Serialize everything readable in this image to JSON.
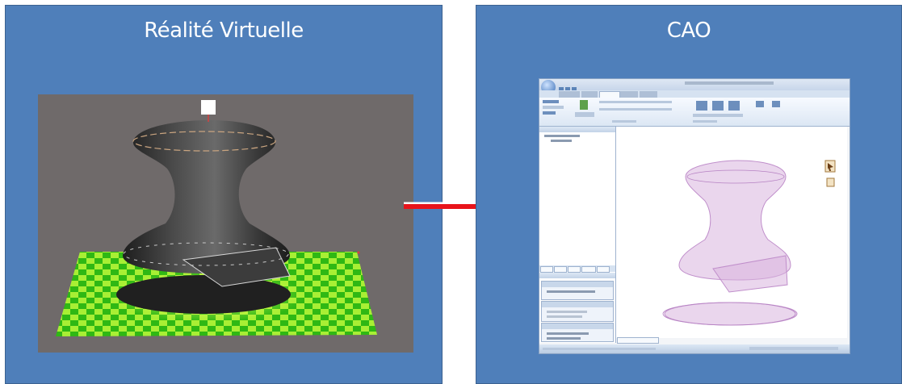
{
  "panels": {
    "left": {
      "title": "Réalité Virtuelle"
    },
    "right": {
      "title": "CAO"
    }
  },
  "colors": {
    "panel_background": "#4f7fba",
    "arrow": "#e8141b",
    "vr_viewport": "#6f6a6a",
    "checker_green": "#3cc21a",
    "checker_light": "#a8ef34",
    "vr_model": "#2b2b2b",
    "cad_model": "#cfa6d6"
  },
  "icons": {
    "arrow": "right-arrow-icon",
    "vr_model": "vr-3d-model",
    "cad_model": "cad-3d-model"
  }
}
